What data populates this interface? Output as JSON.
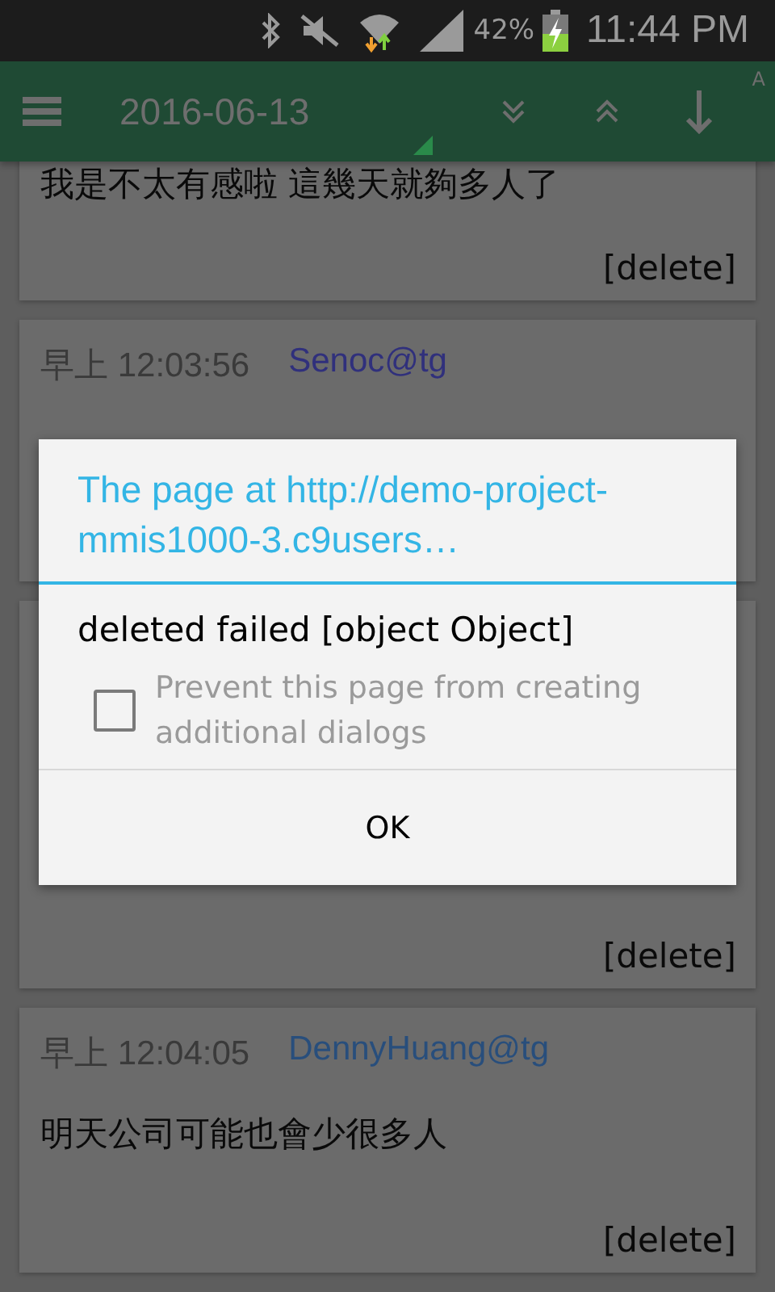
{
  "status_bar": {
    "battery": "42%",
    "time": "11:44 PM"
  },
  "app_bar": {
    "title": "2016-06-13",
    "scroll_bottom_badge": "A"
  },
  "messages": [
    {
      "text": "我是不太有感啦  這幾天就夠多人了",
      "action": "[delete]"
    },
    {
      "time": "早上 12:03:56",
      "user": "Senoc@tg",
      "color": "#30307c"
    },
    {
      "action": "[delete]"
    },
    {
      "time": "早上 12:04:05",
      "user": "DennyHuang@tg",
      "color": "#284e7c",
      "text": "明天公司可能也會少很多人",
      "action": "[delete]"
    }
  ],
  "dialog": {
    "title": "The page at http://demo-project-mmis1000-3.c9users…",
    "message": "deleted failed [object Object]",
    "prevent_checkbox": {
      "label": "Prevent this page from creating additional dialogs",
      "checked": false
    },
    "button": "OK"
  }
}
